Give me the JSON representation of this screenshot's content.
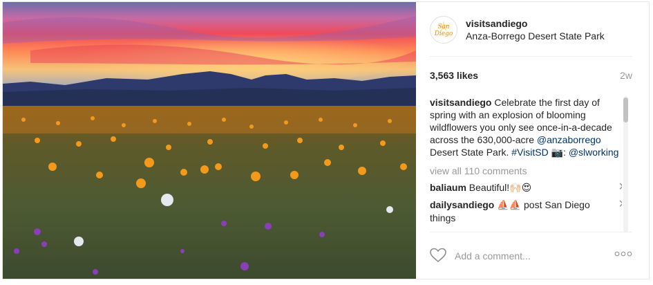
{
  "post": {
    "username": "visitsandiego",
    "location": "Anza-Borrego Desert State Park",
    "likes": "3,563 likes",
    "age": "2w",
    "caption": {
      "author": "visitsandiego",
      "text": "Celebrate the first day of spring with an explosion of blooming wildflowers you only see once-in-a-decade across the 630,000-acre",
      "mention1": "@anzaborrego",
      "text2": "Desert State Park.",
      "hashtag": "#VisitSD",
      "camera_emoji": "📷",
      "mention2_prefix": ":",
      "mention2": "@slworking"
    },
    "view_all": "view all 110 comments",
    "comments": [
      {
        "author": "baliaum",
        "text": "Beautiful!",
        "emoji": "🙌🏻😍"
      },
      {
        "author": "dailysandiego",
        "emoji": "⛵⛵",
        "text": "post San Diego things"
      }
    ],
    "remove_glyph": "✕",
    "add_comment_placeholder": "Add a comment...",
    "avatar_text": "San Diego"
  },
  "colors": {
    "link": "#003569",
    "muted": "#999999",
    "text": "#262626"
  }
}
